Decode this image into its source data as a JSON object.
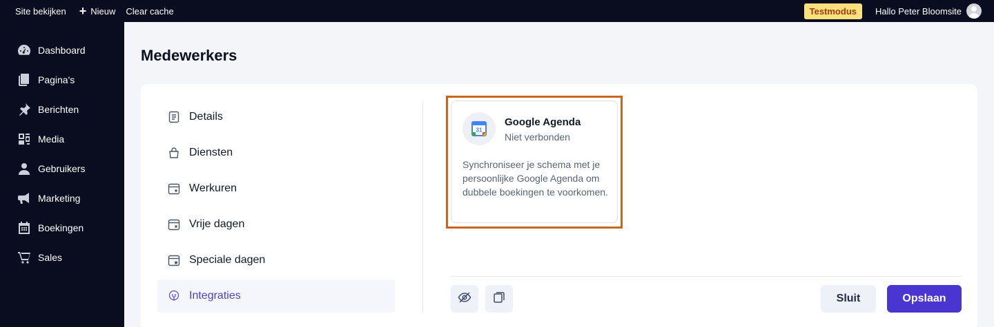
{
  "topbar": {
    "view_site": "Site bekijken",
    "new_label": "Nieuw",
    "new_icon": "plus-icon",
    "clear_cache": "Clear cache",
    "mode_badge": "Testmodus",
    "greeting": "Hallo Peter Bloomsite"
  },
  "sidebar": {
    "items": [
      {
        "label": "Dashboard",
        "icon": "dashboard-icon"
      },
      {
        "label": "Pagina's",
        "icon": "pages-icon"
      },
      {
        "label": "Berichten",
        "icon": "pin-icon"
      },
      {
        "label": "Media",
        "icon": "media-icon"
      },
      {
        "label": "Gebruikers",
        "icon": "user-icon"
      },
      {
        "label": "Marketing",
        "icon": "megaphone-icon"
      },
      {
        "label": "Boekingen",
        "icon": "calendar-icon"
      },
      {
        "label": "Sales",
        "icon": "cart-icon"
      }
    ]
  },
  "page": {
    "title": "Medewerkers"
  },
  "tabs": [
    {
      "label": "Details",
      "icon": "document-icon"
    },
    {
      "label": "Diensten",
      "icon": "bag-icon"
    },
    {
      "label": "Werkuren",
      "icon": "calendar-clock-icon"
    },
    {
      "label": "Vrije dagen",
      "icon": "calendar-x-icon"
    },
    {
      "label": "Speciale dagen",
      "icon": "calendar-star-icon"
    },
    {
      "label": "Integraties",
      "icon": "plug-icon",
      "active": true
    }
  ],
  "integration": {
    "title": "Google Agenda",
    "status": "Niet verbonden",
    "description": "Synchroniseer je schema met je persoonlijke Google Agenda om dubbele boekingen te voorkomen.",
    "icon": "google-calendar-icon",
    "icon_text": "31"
  },
  "footer": {
    "hide_icon": "eye-off-icon",
    "copy_icon": "copy-icon",
    "close_label": "Sluit",
    "save_label": "Opslaan"
  },
  "colors": {
    "accent": "#4a35d1",
    "highlight": "#c9651c",
    "badge_bg": "#fbe07c",
    "sidebar_bg": "#0a0d1f"
  }
}
